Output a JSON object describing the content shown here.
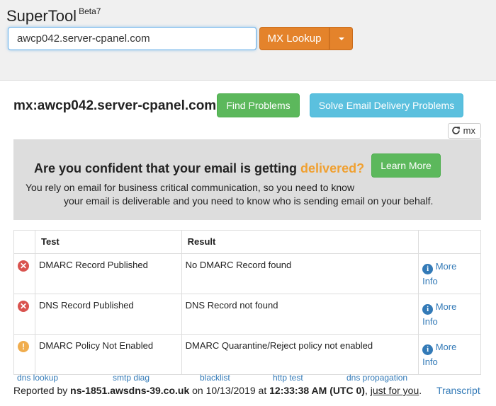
{
  "header": {
    "brand": "SuperTool",
    "beta": "Beta7",
    "search_value": "awcp042.server-cpanel.com",
    "lookup_label": "MX Lookup"
  },
  "result": {
    "title": "mx:awcp042.server-cpanel.com",
    "find_problems": "Find Problems",
    "solve_delivery": "Solve Email Delivery Problems",
    "refresh_label": "mx"
  },
  "promo": {
    "headline_prefix": "Are you confident that your email is getting ",
    "headline_highlight": "delivered?",
    "line1": "You rely on email for business critical communication, so you need to know",
    "line2": "your email is deliverable and you need to know who is sending email on your behalf.",
    "learn_more": "Learn More",
    "highlight_color": "#f0a030"
  },
  "table": {
    "headers": [
      "",
      "Test",
      "Result",
      ""
    ],
    "rows": [
      {
        "status": "error",
        "symbol": "✕",
        "test": "DMARC Record Published",
        "result": "No DMARC Record found",
        "more1": "More",
        "more2": "Info"
      },
      {
        "status": "error",
        "symbol": "✕",
        "test": "DNS Record Published",
        "result": "DNS Record not found",
        "more1": "More",
        "more2": "Info"
      },
      {
        "status": "warning",
        "symbol": "!",
        "test": "DMARC Policy Not Enabled",
        "result": "DMARC Quarantine/Reject policy not enabled",
        "more1": "More",
        "more2": "Info"
      }
    ]
  },
  "footer": {
    "links": [
      "dns lookup",
      "smtp diag",
      "blacklist",
      "http test",
      "dns propagation"
    ],
    "reported_prefix": "Reported by ",
    "server": "ns-1851.awsdns-39.co.uk",
    "on": " on 10/13/2019 at ",
    "time": "12:33:38 AM (UTC 0)",
    "comma": ", ",
    "just_for_you": "just for you",
    "period": ".",
    "transcript": "Transcript"
  },
  "colors": {
    "accent_orange": "#e4832b",
    "success_green": "#5cb85c",
    "info_blue": "#5bc0de",
    "link_blue": "#337ab7",
    "error_red": "#d9534f",
    "warning_orange": "#f0ad4e"
  },
  "icons": {
    "refresh": "refresh-icon",
    "caret": "caret-down-icon",
    "error": "error-circle-icon",
    "warning": "warning-circle-icon",
    "info": "info-circle-icon"
  }
}
